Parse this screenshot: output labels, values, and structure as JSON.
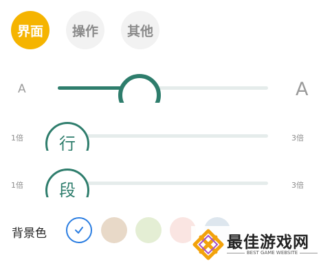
{
  "tabs": [
    {
      "label": "界面",
      "active": true
    },
    {
      "label": "操作",
      "active": false
    },
    {
      "label": "其他",
      "active": false
    }
  ],
  "font_size": {
    "small_label": "A",
    "large_label": "A",
    "level": 0.43
  },
  "line_spacing": {
    "min_label": "1倍",
    "max_label": "3倍",
    "thumb_char": "行",
    "level": 0.0
  },
  "paragraph_spacing": {
    "min_label": "1倍",
    "max_label": "3倍",
    "thumb_char": "段",
    "level": 0.0
  },
  "background": {
    "label": "背景色",
    "swatches": [
      {
        "color": "#ffffff",
        "selected": true
      },
      {
        "color": "#e8d9c8",
        "selected": false
      },
      {
        "color": "#e4eed4",
        "selected": false
      },
      {
        "color": "#fae5e2",
        "selected": false
      },
      {
        "color": "#dde6ee",
        "selected": false
      }
    ]
  },
  "accent_color": "#2e7d6c",
  "selected_tab_color": "#f5b400",
  "check_color": "#2a7de1",
  "watermark": {
    "text": "最佳游戏网",
    "subtext": "BEST GAME WEBSITE"
  }
}
